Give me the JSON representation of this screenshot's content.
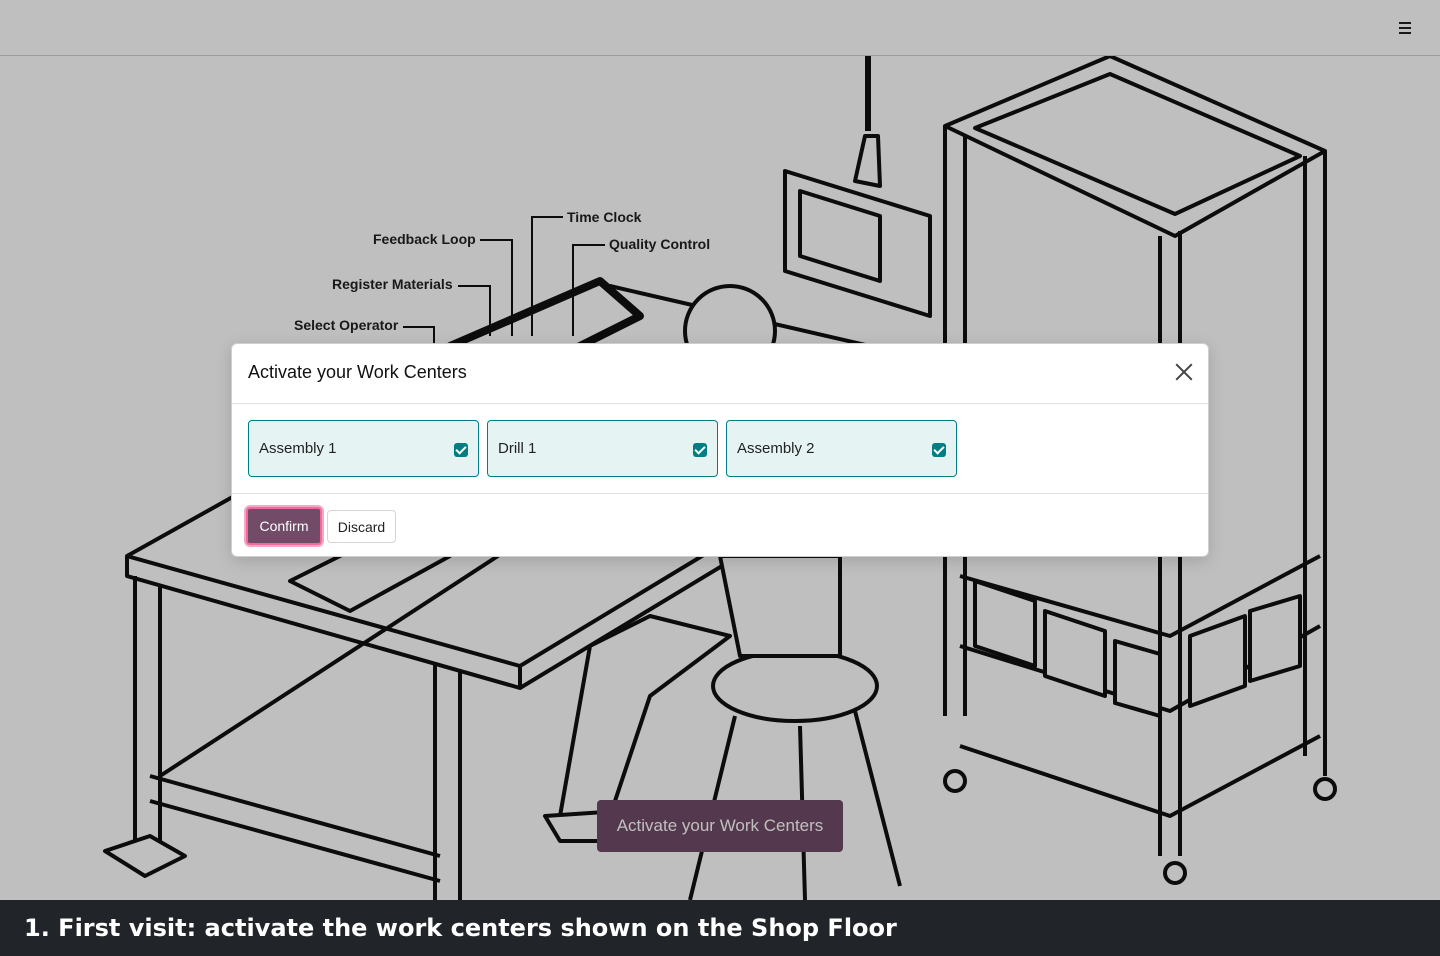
{
  "topbar": {
    "menu_icon": "hamburger-menu-icon"
  },
  "illustration": {
    "callouts": [
      {
        "label": "Time Clock"
      },
      {
        "label": "Feedback Loop"
      },
      {
        "label": "Quality Control"
      },
      {
        "label": "Register Materials"
      },
      {
        "label": "Select Operator"
      }
    ]
  },
  "cta": {
    "label": "Activate your Work Centers"
  },
  "modal": {
    "title": "Activate your Work Centers",
    "close_icon": "close-icon",
    "work_centers": [
      {
        "name": "Assembly 1",
        "checked": true
      },
      {
        "name": "Drill 1",
        "checked": true
      },
      {
        "name": "Assembly 2",
        "checked": true
      }
    ],
    "confirm_label": "Confirm",
    "discard_label": "Discard"
  },
  "caption": {
    "text": "1. First visit: activate the work centers shown on the Shop Floor"
  },
  "colors": {
    "brand": "#714b67",
    "accent": "#017e84",
    "card_bg": "#e6f3f3",
    "caption_bg": "#212529"
  }
}
